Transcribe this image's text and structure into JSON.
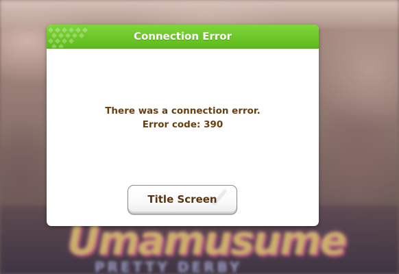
{
  "dialog": {
    "title": "Connection Error",
    "message_lines": [
      "There was a connection error.",
      "Error code: 390"
    ],
    "button_label": "Title Screen"
  },
  "background": {
    "logo_text": "Umamusume",
    "logo_subtext": "PRETTY DERBY"
  },
  "colors": {
    "header_green": "#6cc82a",
    "message_brown": "#6b3d0e",
    "button_text": "#5b350e"
  }
}
